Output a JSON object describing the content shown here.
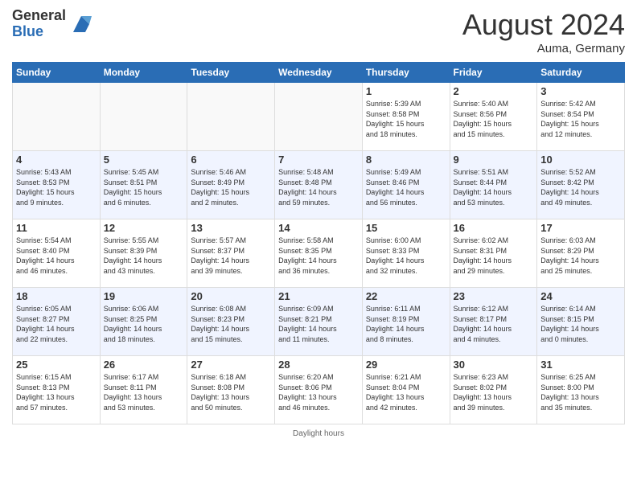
{
  "header": {
    "logo_general": "General",
    "logo_blue": "Blue",
    "month": "August 2024",
    "location": "Auma, Germany"
  },
  "footer": {
    "daylight_label": "Daylight hours"
  },
  "weekdays": [
    "Sunday",
    "Monday",
    "Tuesday",
    "Wednesday",
    "Thursday",
    "Friday",
    "Saturday"
  ],
  "weeks": [
    {
      "days": [
        {
          "num": "",
          "info": ""
        },
        {
          "num": "",
          "info": ""
        },
        {
          "num": "",
          "info": ""
        },
        {
          "num": "",
          "info": ""
        },
        {
          "num": "1",
          "info": "Sunrise: 5:39 AM\nSunset: 8:58 PM\nDaylight: 15 hours\nand 18 minutes."
        },
        {
          "num": "2",
          "info": "Sunrise: 5:40 AM\nSunset: 8:56 PM\nDaylight: 15 hours\nand 15 minutes."
        },
        {
          "num": "3",
          "info": "Sunrise: 5:42 AM\nSunset: 8:54 PM\nDaylight: 15 hours\nand 12 minutes."
        }
      ]
    },
    {
      "days": [
        {
          "num": "4",
          "info": "Sunrise: 5:43 AM\nSunset: 8:53 PM\nDaylight: 15 hours\nand 9 minutes."
        },
        {
          "num": "5",
          "info": "Sunrise: 5:45 AM\nSunset: 8:51 PM\nDaylight: 15 hours\nand 6 minutes."
        },
        {
          "num": "6",
          "info": "Sunrise: 5:46 AM\nSunset: 8:49 PM\nDaylight: 15 hours\nand 2 minutes."
        },
        {
          "num": "7",
          "info": "Sunrise: 5:48 AM\nSunset: 8:48 PM\nDaylight: 14 hours\nand 59 minutes."
        },
        {
          "num": "8",
          "info": "Sunrise: 5:49 AM\nSunset: 8:46 PM\nDaylight: 14 hours\nand 56 minutes."
        },
        {
          "num": "9",
          "info": "Sunrise: 5:51 AM\nSunset: 8:44 PM\nDaylight: 14 hours\nand 53 minutes."
        },
        {
          "num": "10",
          "info": "Sunrise: 5:52 AM\nSunset: 8:42 PM\nDaylight: 14 hours\nand 49 minutes."
        }
      ]
    },
    {
      "days": [
        {
          "num": "11",
          "info": "Sunrise: 5:54 AM\nSunset: 8:40 PM\nDaylight: 14 hours\nand 46 minutes."
        },
        {
          "num": "12",
          "info": "Sunrise: 5:55 AM\nSunset: 8:39 PM\nDaylight: 14 hours\nand 43 minutes."
        },
        {
          "num": "13",
          "info": "Sunrise: 5:57 AM\nSunset: 8:37 PM\nDaylight: 14 hours\nand 39 minutes."
        },
        {
          "num": "14",
          "info": "Sunrise: 5:58 AM\nSunset: 8:35 PM\nDaylight: 14 hours\nand 36 minutes."
        },
        {
          "num": "15",
          "info": "Sunrise: 6:00 AM\nSunset: 8:33 PM\nDaylight: 14 hours\nand 32 minutes."
        },
        {
          "num": "16",
          "info": "Sunrise: 6:02 AM\nSunset: 8:31 PM\nDaylight: 14 hours\nand 29 minutes."
        },
        {
          "num": "17",
          "info": "Sunrise: 6:03 AM\nSunset: 8:29 PM\nDaylight: 14 hours\nand 25 minutes."
        }
      ]
    },
    {
      "days": [
        {
          "num": "18",
          "info": "Sunrise: 6:05 AM\nSunset: 8:27 PM\nDaylight: 14 hours\nand 22 minutes."
        },
        {
          "num": "19",
          "info": "Sunrise: 6:06 AM\nSunset: 8:25 PM\nDaylight: 14 hours\nand 18 minutes."
        },
        {
          "num": "20",
          "info": "Sunrise: 6:08 AM\nSunset: 8:23 PM\nDaylight: 14 hours\nand 15 minutes."
        },
        {
          "num": "21",
          "info": "Sunrise: 6:09 AM\nSunset: 8:21 PM\nDaylight: 14 hours\nand 11 minutes."
        },
        {
          "num": "22",
          "info": "Sunrise: 6:11 AM\nSunset: 8:19 PM\nDaylight: 14 hours\nand 8 minutes."
        },
        {
          "num": "23",
          "info": "Sunrise: 6:12 AM\nSunset: 8:17 PM\nDaylight: 14 hours\nand 4 minutes."
        },
        {
          "num": "24",
          "info": "Sunrise: 6:14 AM\nSunset: 8:15 PM\nDaylight: 14 hours\nand 0 minutes."
        }
      ]
    },
    {
      "days": [
        {
          "num": "25",
          "info": "Sunrise: 6:15 AM\nSunset: 8:13 PM\nDaylight: 13 hours\nand 57 minutes."
        },
        {
          "num": "26",
          "info": "Sunrise: 6:17 AM\nSunset: 8:11 PM\nDaylight: 13 hours\nand 53 minutes."
        },
        {
          "num": "27",
          "info": "Sunrise: 6:18 AM\nSunset: 8:08 PM\nDaylight: 13 hours\nand 50 minutes."
        },
        {
          "num": "28",
          "info": "Sunrise: 6:20 AM\nSunset: 8:06 PM\nDaylight: 13 hours\nand 46 minutes."
        },
        {
          "num": "29",
          "info": "Sunrise: 6:21 AM\nSunset: 8:04 PM\nDaylight: 13 hours\nand 42 minutes."
        },
        {
          "num": "30",
          "info": "Sunrise: 6:23 AM\nSunset: 8:02 PM\nDaylight: 13 hours\nand 39 minutes."
        },
        {
          "num": "31",
          "info": "Sunrise: 6:25 AM\nSunset: 8:00 PM\nDaylight: 13 hours\nand 35 minutes."
        }
      ]
    }
  ]
}
